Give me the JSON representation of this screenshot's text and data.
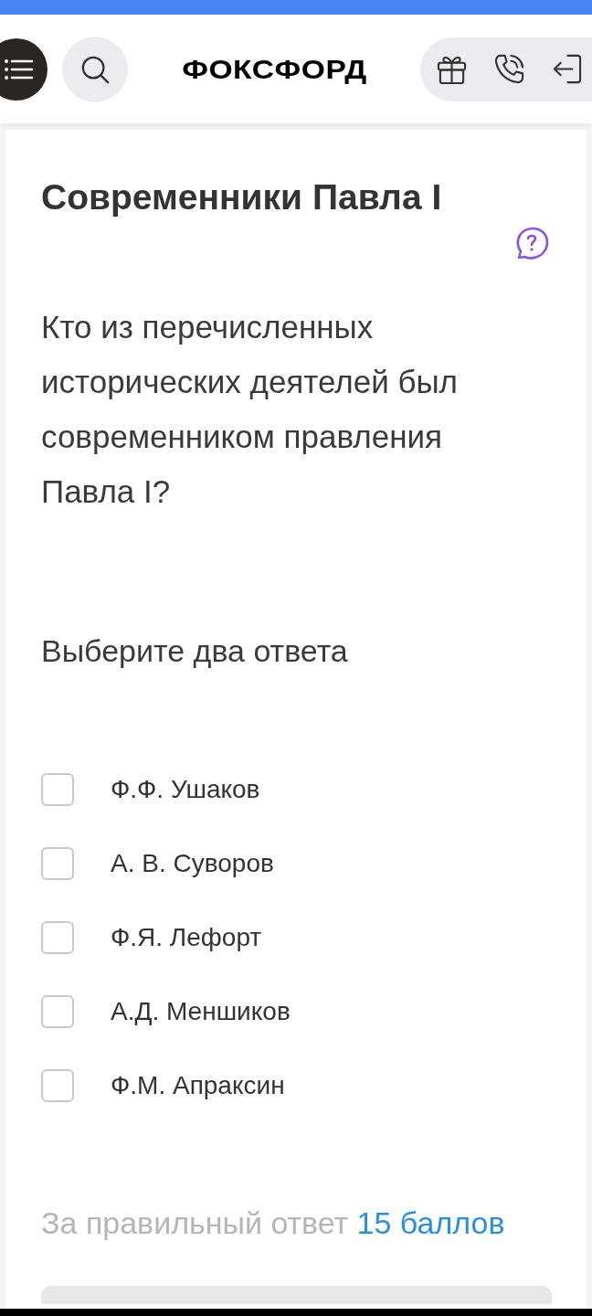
{
  "header": {
    "logo": "ФОКСФОРД"
  },
  "task": {
    "title": "Современники Павла I",
    "question": "Кто из перечисленных исторических деятелей был современником правления Павла I?",
    "instruction": "Выберите два ответа",
    "options": [
      {
        "label": "Ф.Ф. Ушаков",
        "checked": false
      },
      {
        "label": "А. В. Суворов",
        "checked": false
      },
      {
        "label": "Ф.Я. Лефорт",
        "checked": false
      },
      {
        "label": "А.Д. Меншиков",
        "checked": false
      },
      {
        "label": "Ф.М. Апраксин",
        "checked": false
      }
    ],
    "score_label": "За правильный ответ",
    "score_value": "15 баллов"
  }
}
